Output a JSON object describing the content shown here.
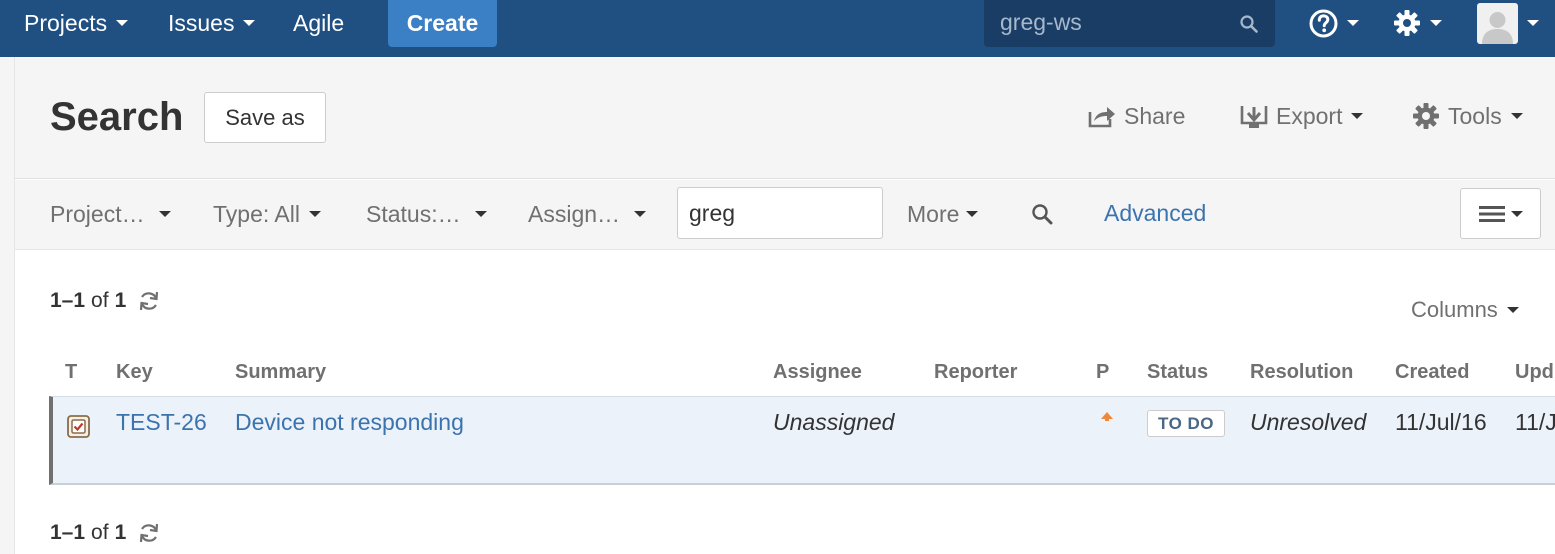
{
  "topnav": {
    "projects_label": "Projects",
    "issues_label": "Issues",
    "agile_label": "Agile",
    "create_label": "Create",
    "search_value": "greg-ws",
    "brand_color": "#205081",
    "create_color": "#3b7fc4",
    "icons": [
      "help-icon",
      "gear-icon",
      "avatar-icon",
      "search-icon"
    ]
  },
  "header": {
    "title": "Search",
    "save_as_label": "Save as",
    "share_label": "Share",
    "export_label": "Export",
    "tools_label": "Tools"
  },
  "filters": {
    "project_label": "Project…",
    "type_label": "Type: All",
    "status_label": "Status:…",
    "assignee_label": "Assign…",
    "text_query_value": "greg",
    "more_label": "More",
    "advanced_label": "Advanced"
  },
  "results": {
    "count_top": {
      "range": "1–1",
      "of": "of",
      "total": "1"
    },
    "count_bottom": {
      "range": "1–1",
      "of": "of",
      "total": "1"
    },
    "columns_label": "Columns",
    "headers": [
      "T",
      "Key",
      "Summary",
      "Assignee",
      "Reporter",
      "P",
      "Status",
      "Resolution",
      "Created",
      "Upd"
    ],
    "rows": [
      {
        "type_icon": "task-icon",
        "key": "TEST-26",
        "summary": "Device not responding",
        "assignee": "Unassigned",
        "reporter": "",
        "priority_icon": "priority-major-icon",
        "status": "TO DO",
        "resolution": "Unresolved",
        "created": "11/Jul/16",
        "updated": "11/J"
      }
    ]
  }
}
